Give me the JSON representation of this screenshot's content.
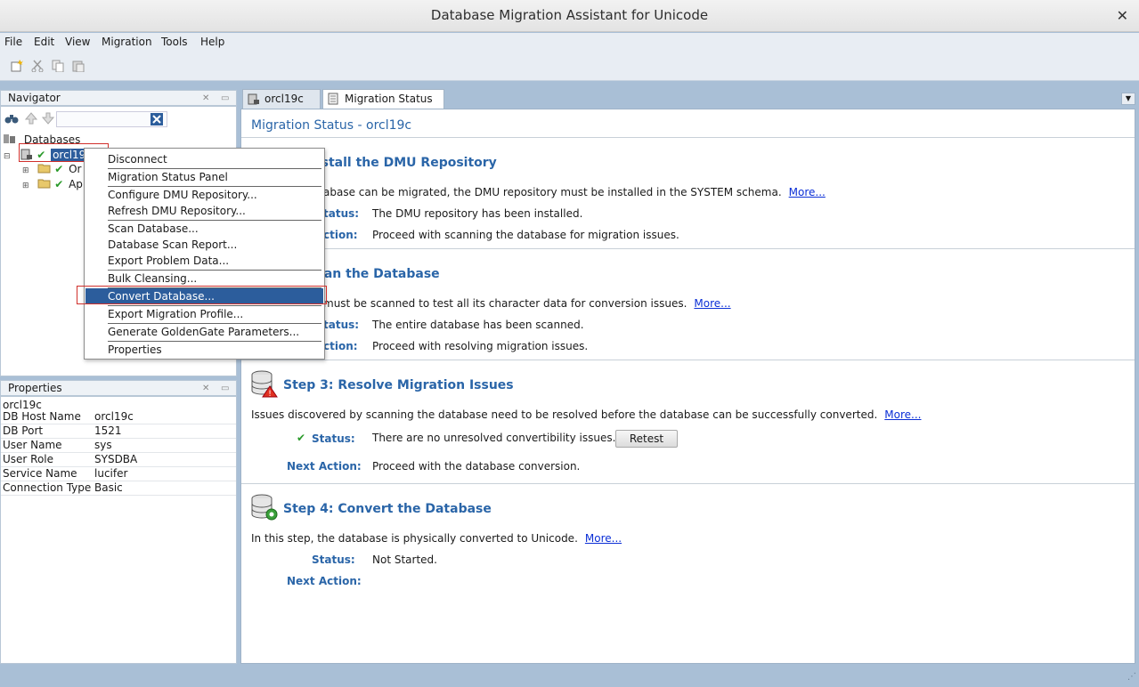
{
  "window": {
    "title": "Database Migration Assistant for Unicode",
    "close_glyph": "✕"
  },
  "menu": [
    "File",
    "Edit",
    "View",
    "Migration",
    "Tools",
    "Help"
  ],
  "toolbar_icons": [
    "new-connection-icon",
    "cut-icon",
    "copy-icon",
    "paste-icon"
  ],
  "navigator": {
    "title": "Navigator",
    "root": "Databases",
    "connection": "orcl19",
    "children": [
      "Or",
      "Ap"
    ]
  },
  "context_menu": {
    "items": [
      "Disconnect",
      "Migration Status Panel",
      "Configure DMU Repository...",
      "Refresh DMU Repository...",
      "Scan Database...",
      "Database Scan Report...",
      "Export Problem Data...",
      "Bulk Cleansing...",
      "Convert Database...",
      "Export Migration Profile...",
      "Generate GoldenGate Parameters...",
      "Properties"
    ],
    "selected": "Convert Database..."
  },
  "properties": {
    "title": "Properties",
    "object": "orcl19c",
    "rows": [
      {
        "key": "DB Host Name",
        "value": "orcl19c"
      },
      {
        "key": "DB Port",
        "value": "1521"
      },
      {
        "key": "User Name",
        "value": "sys"
      },
      {
        "key": "User Role",
        "value": "SYSDBA"
      },
      {
        "key": "Service Name",
        "value": "lucifer"
      },
      {
        "key": "Connection Type",
        "value": "Basic"
      }
    ]
  },
  "tabs": [
    {
      "label": "orcl19c"
    },
    {
      "label": "Migration Status"
    }
  ],
  "main": {
    "title": "Migration Status - orcl19c",
    "status_label": "Status:",
    "next_label": "Next Action:",
    "more": "More...",
    "step1": {
      "title": ": Install the DMU Repository",
      "desc": "abase can be migrated, the DMU repository must be installed in the SYSTEM schema.",
      "status_lbl": "tatus:",
      "status": "The DMU repository has been installed.",
      "next_lbl": "ction:",
      "next": "Proceed with scanning the database for migration issues."
    },
    "step2": {
      "title": ": Scan the Database",
      "desc": "must be scanned to test all its character data for conversion issues.",
      "status_lbl": "tatus:",
      "status": "The entire database has been scanned.",
      "next_lbl": "ction:",
      "next": "Proceed with resolving migration issues."
    },
    "step3": {
      "title": "Step 3: Resolve Migration Issues",
      "desc": "Issues discovered by scanning the database need to be resolved before the database can be successfully converted.",
      "status": "There are no unresolved convertibility issues.",
      "button": "Retest",
      "next": "Proceed with the database conversion."
    },
    "step4": {
      "title": "Step 4: Convert the Database",
      "desc": "In this step, the database is physically converted to Unicode.",
      "status": "Not Started.",
      "next": ""
    }
  }
}
